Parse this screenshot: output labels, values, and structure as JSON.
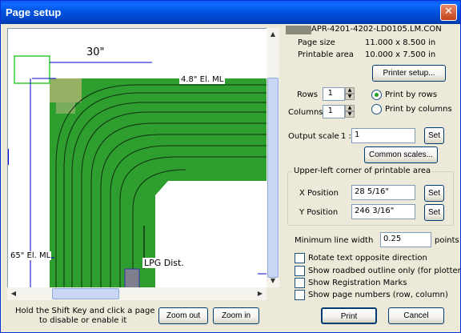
{
  "window": {
    "title": "Page setup",
    "close_symbol": "✕"
  },
  "preview": {
    "labels": {
      "top_dim": "30\"",
      "ml_top": "4.8\" El. ML",
      "ml_left": "65\" El. ML",
      "lpg": "LPG Dist."
    },
    "colors": {
      "track_green": "#2e9e2e",
      "highlight": "#a8b46c",
      "page_outline": "#33cc33",
      "dim_line": "#0000cc"
    }
  },
  "file": {
    "name": "APR-4201-4202-LD0105.LM.CON"
  },
  "page_size": {
    "label": "Page size",
    "value": "11.000 x 8.500 in"
  },
  "printable_area": {
    "label": "Printable area",
    "value": "10.000 x 7.500 in"
  },
  "buttons": {
    "printer_setup": "Printer setup...",
    "set_scale": "Set",
    "common_scales": "Common scales...",
    "set_x": "Set",
    "set_y": "Set",
    "zoom_out": "Zoom out",
    "zoom_in": "Zoom in",
    "print": "Print",
    "cancel": "Cancel"
  },
  "rows": {
    "label": "Rows",
    "value": "1"
  },
  "columns": {
    "label": "Columns",
    "value": "1"
  },
  "print_order": {
    "by_rows": "Print by rows",
    "by_columns": "Print by columns",
    "selected": "rows"
  },
  "output_scale": {
    "label": "Output scale",
    "prefix": "1 :",
    "value": "1"
  },
  "corner": {
    "title": "Upper-left corner of printable area",
    "x_label": "X Position",
    "x_value": "28 5/16\"",
    "y_label": "Y Position",
    "y_value": "246 3/16\""
  },
  "min_line": {
    "label": "Minimum line width",
    "value": "0.25",
    "unit": "points"
  },
  "options": [
    {
      "label": "Rotate text opposite direction",
      "checked": false
    },
    {
      "label": "Show roadbed outline only (for plotters)",
      "checked": false
    },
    {
      "label": "Show Registration Marks",
      "checked": false
    },
    {
      "label": "Show page numbers (row, column)",
      "checked": false
    }
  ],
  "hint": {
    "line1": "Hold the Shift Key and click a page",
    "line2": "to disable or enable it"
  }
}
